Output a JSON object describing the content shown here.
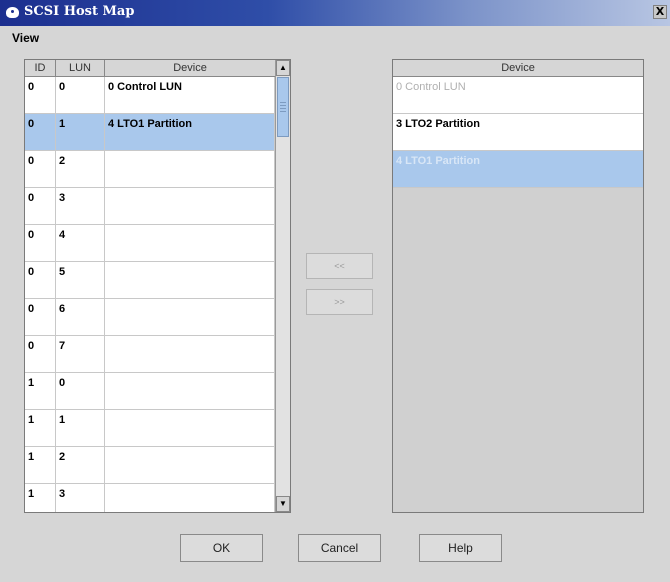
{
  "window": {
    "title": "SCSI Host Map",
    "close_glyph": "X",
    "icon": "app-icon"
  },
  "menu": {
    "view": "View"
  },
  "left_table": {
    "columns": [
      "ID",
      "LUN",
      "Device"
    ],
    "rows": [
      {
        "id": "0",
        "lun": "0",
        "device": "0 Control LUN"
      },
      {
        "id": "0",
        "lun": "1",
        "device": "4  LTO1 Partition"
      },
      {
        "id": "0",
        "lun": "2",
        "device": ""
      },
      {
        "id": "0",
        "lun": "3",
        "device": ""
      },
      {
        "id": "0",
        "lun": "4",
        "device": ""
      },
      {
        "id": "0",
        "lun": "5",
        "device": ""
      },
      {
        "id": "0",
        "lun": "6",
        "device": ""
      },
      {
        "id": "0",
        "lun": "7",
        "device": ""
      },
      {
        "id": "1",
        "lun": "0",
        "device": ""
      },
      {
        "id": "1",
        "lun": "1",
        "device": ""
      },
      {
        "id": "1",
        "lun": "2",
        "device": ""
      },
      {
        "id": "1",
        "lun": "3",
        "device": ""
      }
    ],
    "scroll_up_glyph": "▲",
    "scroll_down_glyph": "▼"
  },
  "middle_buttons": {
    "move_left": "<<",
    "move_right": ">>"
  },
  "right_table": {
    "column": "Device",
    "rows": [
      "0 Control LUN",
      "3  LTO2 Partition",
      "4 LTO1 Partition"
    ]
  },
  "buttons": {
    "ok": "OK",
    "cancel": "Cancel",
    "help": "Help"
  },
  "colors": {
    "selection": "#a9c8ec",
    "titlebar": "#1c2f8f"
  }
}
